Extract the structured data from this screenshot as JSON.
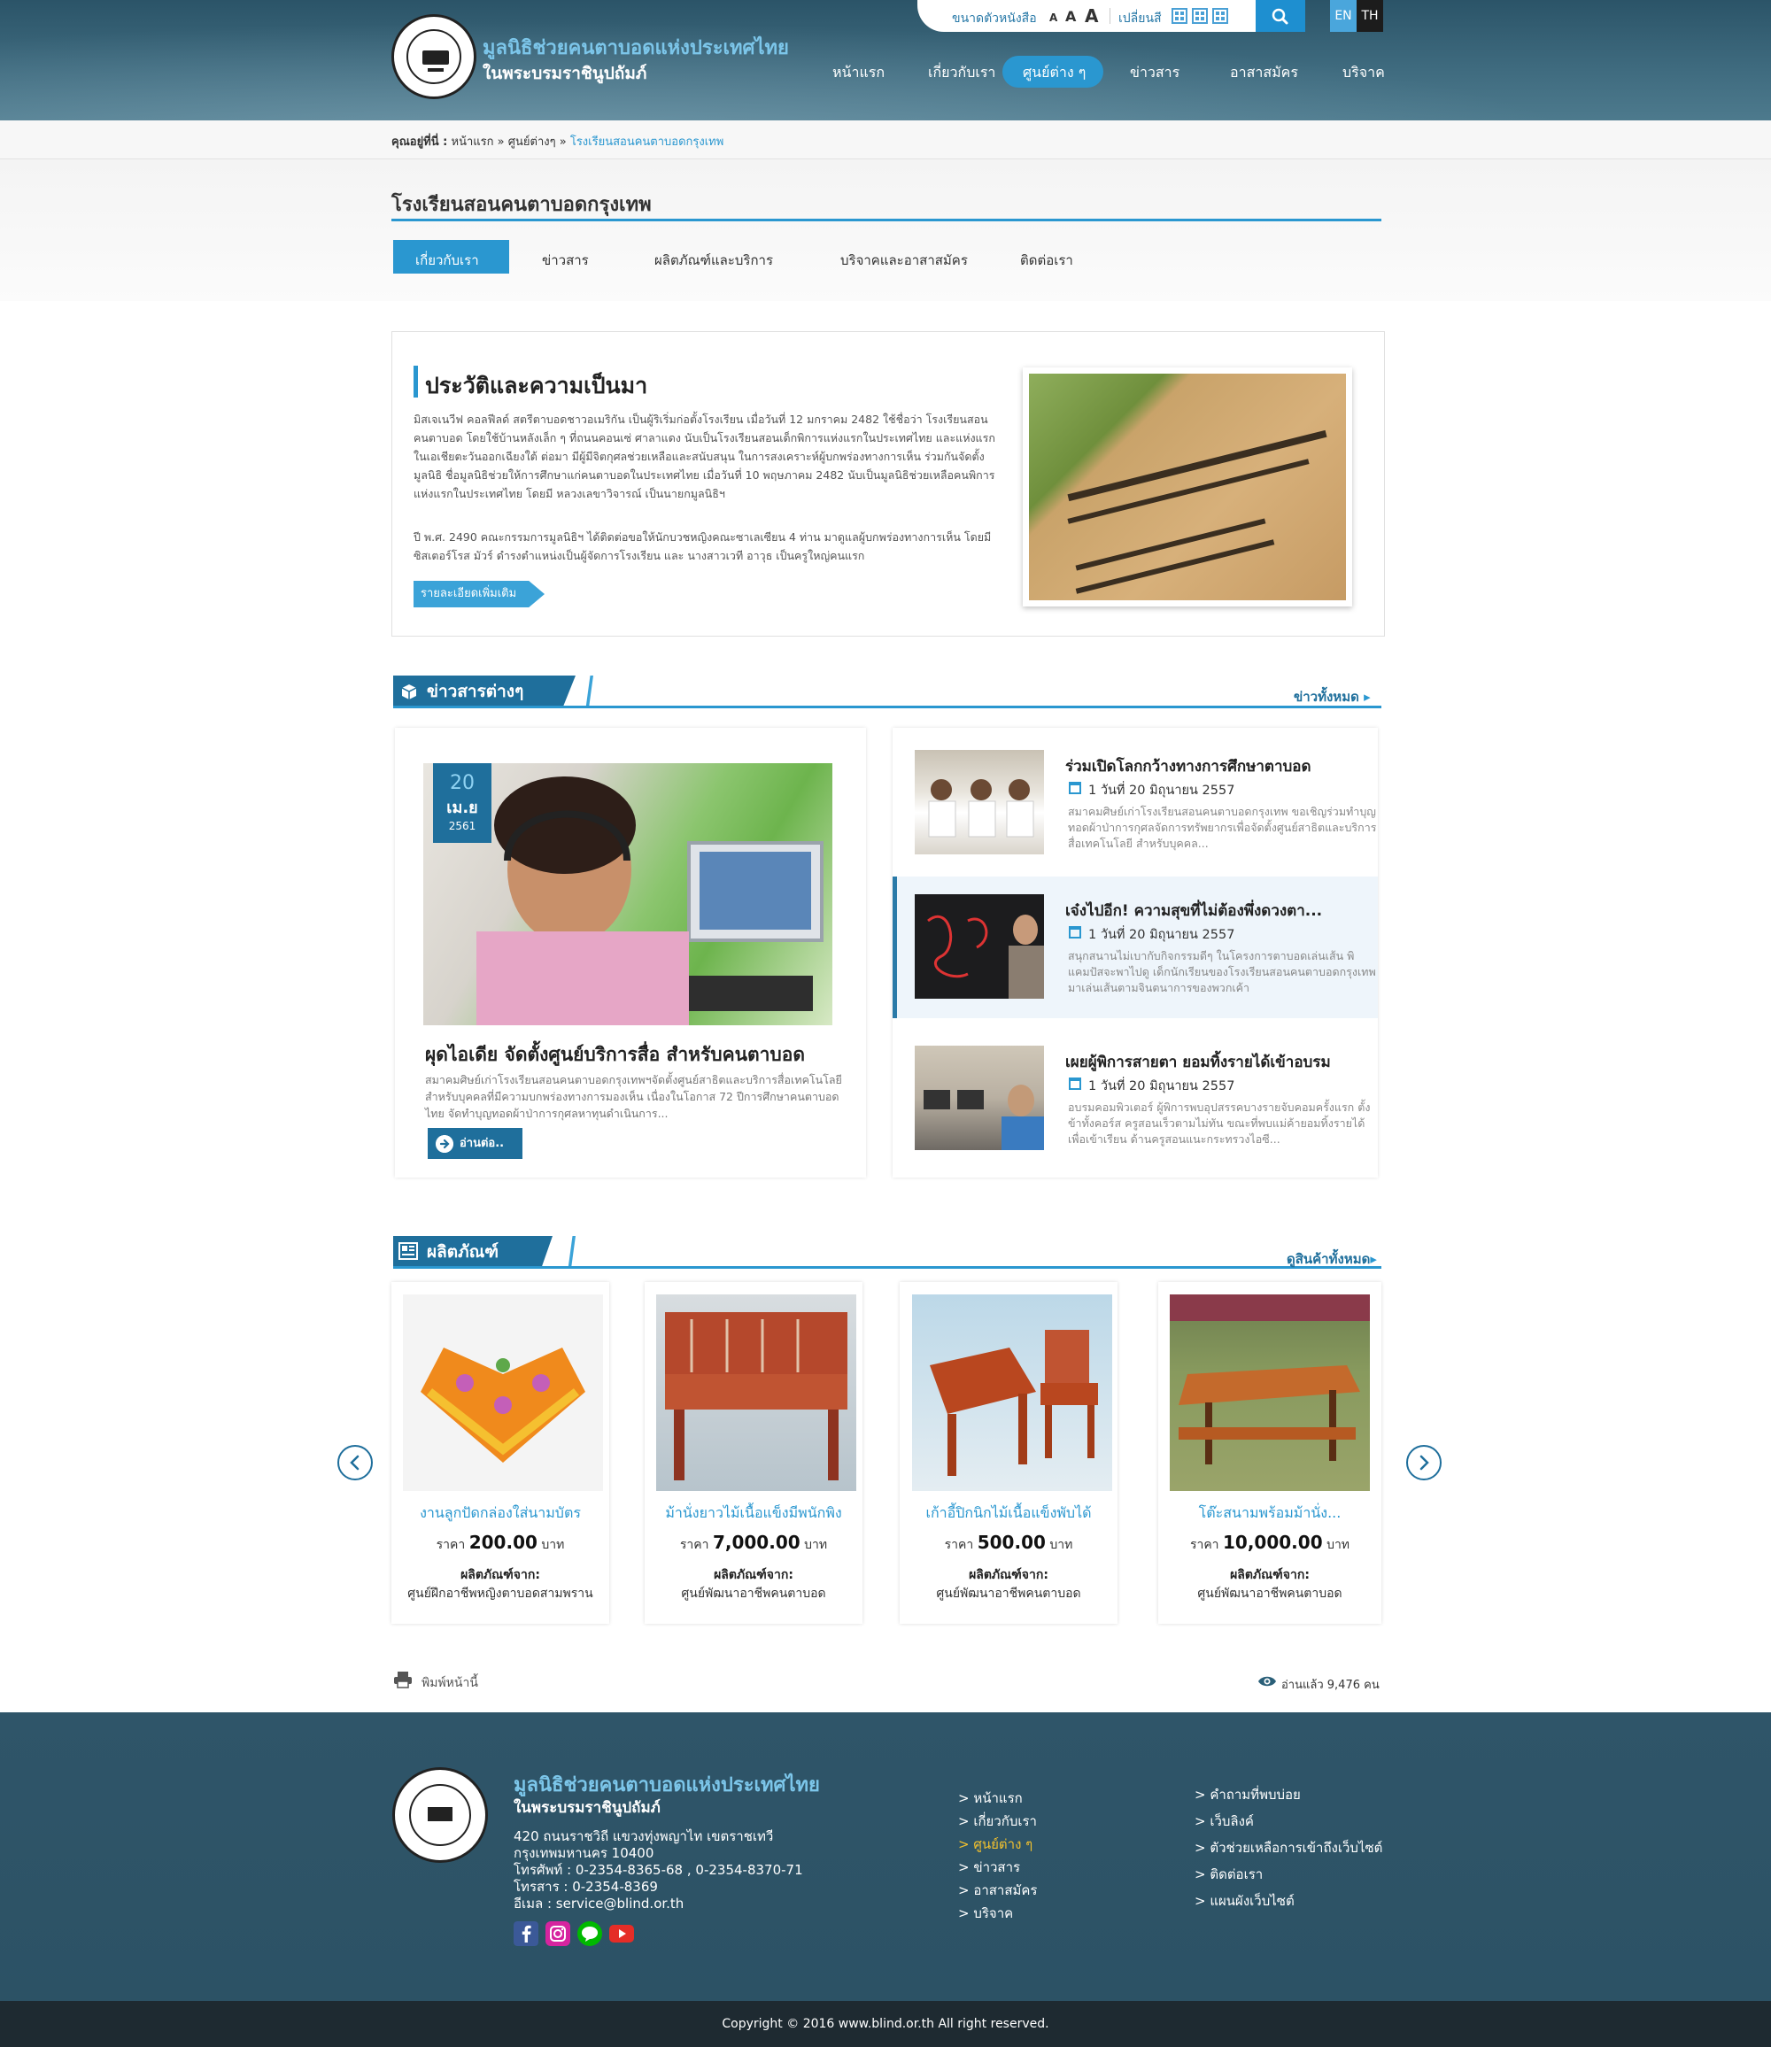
{
  "header": {
    "org_name": "มูลนิธิช่วยคนตาบอดแห่งประเทศไทย",
    "org_sub": "ในพระบรมราชินูปถัมภ์",
    "font_size_label": "ขนาดตัวหนังสือ",
    "font_a": "A",
    "color_label": "เปลี่ยนสี",
    "lang_en": "EN",
    "lang_th": "TH",
    "accent": "#2a97d0"
  },
  "nav": {
    "items": [
      "หน้าแรก",
      "เกี่ยวกับเรา",
      "ศูนย์ต่าง ๆ",
      "ข่าวสาร",
      "อาสาสมัคร",
      "บริจาค"
    ],
    "active": "ศูนย์ต่าง ๆ"
  },
  "breadcrumb": {
    "prefix": "คุณอยู่ที่นี่ :",
    "home": "หน้าแรก",
    "sep": "»",
    "centers": "ศูนย์ต่างๆ",
    "current": "โรงเรียนสอนคนตาบอดกรุงเทพ"
  },
  "page": {
    "title": "โรงเรียนสอนคนตาบอดกรุงเทพ",
    "subnav": [
      "เกี่ยวกับเรา",
      "ข่าวสาร",
      "ผลิตภัณฑ์และบริการ",
      "บริจาคและอาสาสมัคร",
      "ติดต่อเรา"
    ]
  },
  "about": {
    "title": "ประวัติและความเป็นมา",
    "p1": "มิสเจเนวีฟ คอลฟีลด์ สตรีตาบอดชาวอเมริกัน เป็นผู้ริเริ่มก่อตั้งโรงเรียน เมื่อวันที่ 12 มกราคม 2482 ใช้ชื่อว่า โรงเรียนสอนคนตาบอด โดยใช้บ้านหลังเล็ก ๆ ที่ถนนคอนเซ่ ศาลาแดง นับเป็นโรงเรียนสอนเด็กพิการแห่งแรกในประเทศไทย และแห่งแรกในเอเชียตะวันออกเฉียงใต้ ต่อมา มีผู้มีจิตกุศลช่วยเหลือและสนับสนุน ในการสงเคราะห์ผู้บกพร่องทางการเห็น ร่วมกันจัดตั้งมูลนิธิ ชื่อมูลนิธิช่วยให้การศึกษาแก่คนตาบอดในประเทศไทย เมื่อวันที่ 10 พฤษภาคม 2482 นับเป็นมูลนิธิช่วยเหลือคนพิการแห่งแรกในประเทศไทย โดยมี หลวงเลขาวิจารณ์ เป็นนายกมูลนิธิฯ",
    "p2": "ปี พ.ศ. 2490 คณะกรรมการมูลนิธิฯ ได้ติดต่อขอให้นักบวชหญิงคณะซาเลเซียน 4 ท่าน มาดูแลผู้บกพร่องทางการเห็น โดยมีซิสเตอร์โรส มัวร์ ดำรงตำแหน่งเป็นผู้จัดการโรงเรียน และ นางสาวเวที อาวุธ เป็นครูใหญ่คนแรก",
    "more": "รายละเอียดเพิ่มเติม"
  },
  "news": {
    "section_title": "ข่าวสารต่างๆ",
    "all_link": "ข่าวทั้งหมด",
    "featured": {
      "day": "20",
      "month": "เม.ย",
      "year": "2561",
      "title": "ผุดไอเดีย จัดตั้งศูนย์บริการสื่อ สำหรับคนตาบอด",
      "desc": "สมาคมศิษย์เก่าโรงเรียนสอนคนตาบอดกรุงเทพฯจัดตั้งศูนย์สาธิตและบริการสื่อเทคโนโลยี สำหรับบุคคลที่มีความบกพร่องทางการมองเห็น เนื่องในโอกาส 72 ปีการศึกษาคนตาบอดไทย จัดทำบุญทอดผ้าป่าการกุศลหาทุนดำเนินการ...",
      "read_more": "อ่านต่อ.."
    },
    "items": [
      {
        "title": "ร่วมเปิดโลกกว้างทางการศึกษาตาบอด",
        "date": "1 วันที่ 20 มิถุนายน 2557",
        "desc": "สมาคมศิษย์เก่าโรงเรียนสอนคนตาบอดกรุงเทพ ขอเชิญร่วมทำบุญทอดผ้าป่าการกุศลจัดการทรัพยากรเพื่อจัดตั้งศูนย์สาธิตและบริการสื่อเทคโนโลยี สำหรับบุคคล..."
      },
      {
        "title": "เจ๋งไปอีก! ความสุขที่ไม่ต้องพึ่งดวงตา...",
        "date": "1 วันที่ 20 มิถุนายน 2557",
        "desc": "สนุกสนานไม่เบากับกิจกรรมดีๆ ในโครงการตาบอดเล่นเส้น พิแคมปัสจะพาไปดู เด็กนักเรียนของโรงเรียนสอนคนตาบอดกรุงเทพ มาเล่นเส้นตามจินตนาการของพวกเค้า"
      },
      {
        "title": "เผยผู้พิการสายตา ยอมทิ้งรายได้เข้าอบรม",
        "date": "1 วันที่ 20 มิถุนายน 2557",
        "desc": "อบรมคอมพิวเตอร์ ผู้พิการพบอุปสรรคบางรายจับคอมครั้งแรก ตั้งข้าทั้งคอร์ส ครูสอนเร็วตามไม่ทัน ขณะที่พบแม่ค้ายอมทิ้งรายได้เพื่อเข้าเรียน ด้านครูสอนแนะกระทรวงไอซี..."
      }
    ]
  },
  "products": {
    "section_title": "ผลิตภัณฑ์",
    "all_link": "ดูสินค้าทั้งหมด",
    "price_prefix": "ราคา",
    "price_suffix": "บาท",
    "from_label": "ผลิตภัณฑ์จาก:",
    "items": [
      {
        "name": "งานลูกปัดกล่องใส่นามบัตร",
        "price": "200.00",
        "center": "ศูนย์ฝึกอาชีพหญิงตาบอดสามพราน"
      },
      {
        "name": "ม้านั่งยาวไม้เนื้อแข็งมีพนักพิง",
        "price": "7,000.00",
        "center": "ศูนย์พัฒนาอาชีพคนตาบอด"
      },
      {
        "name": "เก้าอี้ปิกนิกไม้เนื้อแข็งพับได้",
        "price": "500.00",
        "center": "ศูนย์พัฒนาอาชีพคนตาบอด"
      },
      {
        "name": "โต๊ะสนามพร้อมม้านั่ง...",
        "price": "10,000.00",
        "center": "ศูนย์พัฒนาอาชีพคนตาบอด"
      }
    ]
  },
  "utility": {
    "print": "พิมพ์หน้านี้",
    "views": "อ่านแล้ว 9,476 คน"
  },
  "footer": {
    "org_name": "มูลนิธิช่วยคนตาบอดแห่งประเทศไทย",
    "org_sub": "ในพระบรมราชินูปถัมภ์",
    "address1": "420 ถนนราชวิถี แขวงทุ่งพญาไท เขตราชเทวี",
    "address2": "กรุงเทพมหานคร 10400",
    "phone": "โทรศัพท์ : 0-2354-8365-68 , 0-2354-8370-71",
    "fax": "โทรสาร : 0-2354-8369",
    "email": "อีเมล : service@blind.or.th",
    "nav": [
      "> หน้าแรก",
      "> เกี่ยวกับเรา",
      "> ศูนย์ต่าง ๆ",
      "> ข่าวสาร",
      "> อาสาสมัคร",
      "> บริจาค"
    ],
    "links": [
      "> คำถามที่พบบ่อย",
      "> เว็บลิงค์",
      "> ตัวช่วยเหลือการเข้าถึงเว็บไซต์",
      "> ติดต่อเรา",
      "> แผนผังเว็บไซต์"
    ],
    "copyright": "Copyright © 2016 www.blind.or.th All right reserved."
  }
}
